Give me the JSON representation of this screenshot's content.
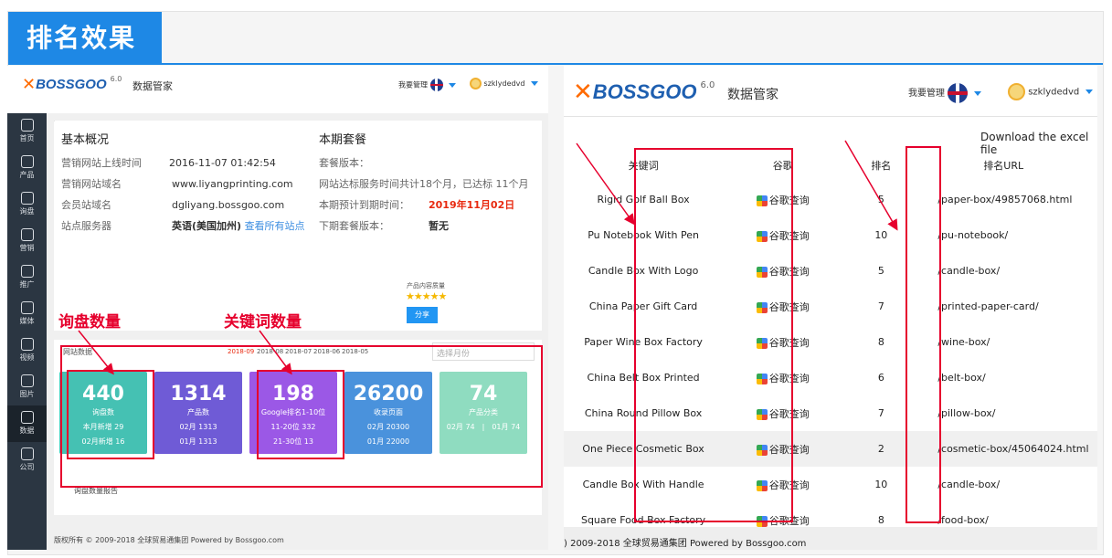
{
  "banner": {
    "title": "排名效果"
  },
  "left": {
    "header": {
      "logo_x": "✕",
      "logo_text": "BOSSGOO",
      "logo_com": ".com",
      "version": "6.0",
      "app_name": "数据管家",
      "manage_label": "我要管理",
      "username": "szklydedvd"
    },
    "sidebar": [
      {
        "label": "首页",
        "icon": "home-icon"
      },
      {
        "label": "产品",
        "icon": "box-icon"
      },
      {
        "label": "询盘",
        "icon": "inquiry-icon"
      },
      {
        "label": "营销",
        "icon": "marketing-icon"
      },
      {
        "label": "推广",
        "icon": "promote-icon"
      },
      {
        "label": "媒体",
        "icon": "media-icon"
      },
      {
        "label": "视频",
        "icon": "video-icon"
      },
      {
        "label": "图片",
        "icon": "image-icon"
      },
      {
        "label": "数据",
        "icon": "chart-icon"
      },
      {
        "label": "公司",
        "icon": "company-icon"
      }
    ],
    "overview": {
      "title": "基本概况",
      "rows": [
        {
          "k": "营销网站上线时间",
          "v": "2016-11-07 01:42:54"
        },
        {
          "k": "营销网站域名",
          "v": "www.liyangprinting.com"
        },
        {
          "k": "会员站域名",
          "v": "dgliyang.bossgoo.com"
        },
        {
          "k": "站点服务器",
          "v": "英语(美国加州)",
          "link": "查看所有站点"
        }
      ]
    },
    "package": {
      "title": "本期套餐",
      "rows": [
        {
          "k": "套餐版本：",
          "v": ""
        },
        {
          "k": "网站达标服务时间共计18个月，已达标 11个月",
          "v": ""
        },
        {
          "k": "本期预计到期时间：",
          "v": "2019年11月02日"
        },
        {
          "k": "下期套餐版本：",
          "v": "暂无"
        }
      ],
      "quality_label": "产品内容质量",
      "stars": "★★★★★",
      "share_label": "分享"
    },
    "stats": {
      "title": "网站数据",
      "months": [
        "2018-09",
        "2018-08",
        "2018-07",
        "2018-06",
        "2018-05"
      ],
      "month_placeholder": "选择月份",
      "tiles": [
        {
          "n": "440",
          "l": "询盘数",
          "s1": "本月新增 29",
          "s2": "02月新增 16",
          "color": "#45c1b3"
        },
        {
          "n": "1314",
          "l": "产品数",
          "s1": "02月 1313",
          "s2": "01月 1313",
          "color": "#6f5bd6"
        },
        {
          "n": "198",
          "l": "Google排名1-10位",
          "s1": "11-20位 332",
          "s2": "21-30位 13",
          "color": "#9b58e6"
        },
        {
          "n": "26200",
          "l": "收录页面",
          "s1": "02月 20300",
          "s2": "01月 22000",
          "color": "#4a92dc"
        },
        {
          "n": "74",
          "l": "产品分类",
          "s1": "02月 74　|　01月 74",
          "s2": "",
          "color": "#8fdcc0"
        }
      ],
      "report_title": "询盘数量报告"
    },
    "annotations": {
      "inquiry": "询盘数量",
      "keywords": "关键词数量"
    },
    "footer": "版权所有 © 2009-2018 全球贸易通集团 Powered by Bossgoo.com"
  },
  "right": {
    "header": {
      "logo_x": "✕",
      "logo_text": "BOSSGOO",
      "logo_com": ".com",
      "version": "6.0",
      "app_name": "数据管家",
      "manage_label": "我要管理",
      "username": "szklydedvd"
    },
    "download_label": "Download the excel file",
    "columns": [
      "关键词",
      "谷歌",
      "排名",
      "排名URL"
    ],
    "google_link": "谷歌查询",
    "rows": [
      {
        "keyword": "Rigid Golf Ball Box",
        "rank": "5",
        "url": "/paper-box/49857068.html"
      },
      {
        "keyword": "Pu Notebook With Pen",
        "rank": "10",
        "url": "/pu-notebook/"
      },
      {
        "keyword": "Candle Box With Logo",
        "rank": "5",
        "url": "/candle-box/"
      },
      {
        "keyword": "China Paper Gift Card",
        "rank": "7",
        "url": "/printed-paper-card/"
      },
      {
        "keyword": "Paper Wine Box Factory",
        "rank": "8",
        "url": "/wine-box/"
      },
      {
        "keyword": "China Belt Box Printed",
        "rank": "6",
        "url": "/belt-box/"
      },
      {
        "keyword": "China Round Pillow Box",
        "rank": "7",
        "url": "/pillow-box/"
      },
      {
        "keyword": "One Piece Cosmetic Box",
        "rank": "2",
        "url": "/cosmetic-box/45064024.html"
      },
      {
        "keyword": "Candle Box With Handle",
        "rank": "10",
        "url": "/candle-box/"
      },
      {
        "keyword": "Square Food Box Factory",
        "rank": "8",
        "url": "/food-box/"
      }
    ],
    "footer": ") 2009-2018 全球贸易通集团 Powered by Bossgoo.com"
  }
}
